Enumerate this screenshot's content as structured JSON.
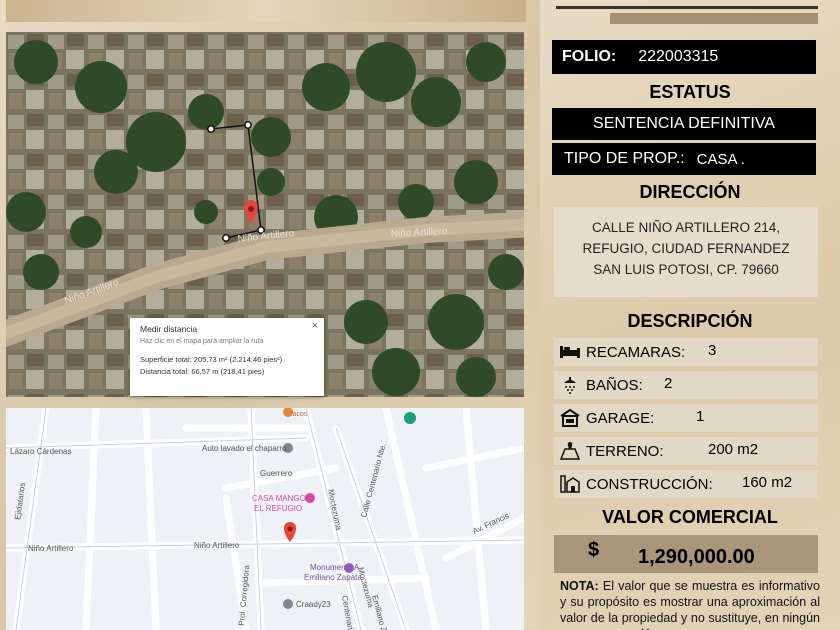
{
  "satellite": {
    "street_label_1": "Niño Artillero",
    "street_label_2": "Niño Artillero",
    "street_label_3": "Niño Artillero"
  },
  "measure": {
    "title": "Medir distancia",
    "subtitle": "Haz clic en el mapa para ampliar la ruta",
    "area": "Superficie total: 205,73 m² (2.214,46 pies²)",
    "distance": "Distancia total: 66,57 m (218,41 pies)",
    "close": "×"
  },
  "map": {
    "labels": {
      "lazaro": "Lázaro Cárdenas",
      "autolavado": "Auto lavado el chaparro",
      "guerrero": "Guerrero",
      "casa_mango_1": "CASA MANGO",
      "casa_mango_2": "EL REFUGIO",
      "nino_1": "Niño Artillero",
      "nino_2": "Niño Artillero",
      "francisco": "Av. Francis",
      "monumento_1": "Monumento A",
      "monumento_2": "Emiliano Zapata",
      "craady": "Craady23",
      "ejidatarios": "Ejidatarios",
      "moctezuma_1": "Moctezuma",
      "moctezuma_2": "Moctezuma",
      "centenario_1": "Calle Centenario Nte.",
      "centenario_2": "Centenario",
      "corregidora": "Prol. Corregidora",
      "emiliano": "Emiliano Zapat",
      "top_place": "Tacos"
    }
  },
  "folio": {
    "label": "FOLIO:",
    "value": "222003315"
  },
  "estatus": {
    "heading": "ESTATUS",
    "value": "SENTENCIA DEFINITIVA"
  },
  "tipo": {
    "label": "TIPO DE PROP.:",
    "value": "CASA ."
  },
  "direccion": {
    "heading": "DIRECCIÓN",
    "line1": "CALLE NIÑO ARTILLERO 214,",
    "line2": "REFUGIO, CIUDAD FERNANDEZ",
    "line3": "SAN LUIS POTOSI, CP. 79660"
  },
  "descripcion": {
    "heading": "DESCRIPCIÓN",
    "recamaras": {
      "label": "RECAMARAS:",
      "value": "3",
      "icon": "bed-icon"
    },
    "banos": {
      "label": "BAÑOS:",
      "value": "2",
      "icon": "shower-icon"
    },
    "garage": {
      "label": "GARAGE:",
      "value": "1",
      "icon": "garage-icon"
    },
    "terreno": {
      "label": "TERRENO:",
      "value": "200 m2",
      "icon": "land-icon"
    },
    "construccion": {
      "label": "CONSTRUCCIÓN:",
      "value": "160 m2",
      "icon": "building-icon"
    }
  },
  "valor": {
    "heading": "VALOR COMERCIAL",
    "currency": "$",
    "amount": "1,290,000.00"
  },
  "note": {
    "label": "NOTA:",
    "text": " El valor que se muestra es informativo y su propósito es mostrar una aproximación al valor de la propiedad y no sustituye, en ningún caso, a un avalúo"
  },
  "colors": {
    "black_bar": "#000000",
    "pin": "#e8453c",
    "price_box": "#a9957a"
  }
}
